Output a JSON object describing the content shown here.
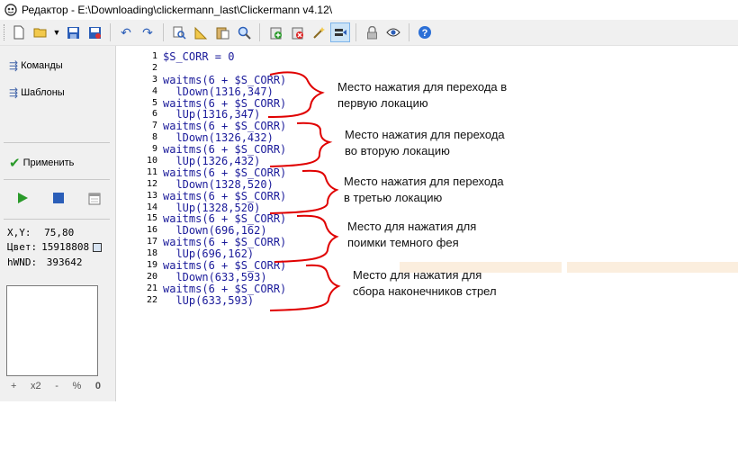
{
  "title": "Редактор - E:\\Downloading\\clickermann_last\\Clickermann v4.12\\",
  "toolbar": {
    "icons": [
      "new-file",
      "open-folder",
      "dropdown",
      "save",
      "save-as",
      "undo",
      "redo",
      "find",
      "measure",
      "paste",
      "search",
      "add",
      "delete",
      "magic-wand",
      "send",
      "lock",
      "eye",
      "help"
    ],
    "active": "send"
  },
  "sidebar": {
    "commands_label": "Команды",
    "templates_label": "Шаблоны",
    "apply_label": "Применить",
    "xy_label": "X,Y:",
    "xy_value": "75,80",
    "color_label": "Цвет:",
    "color_value": "15918808",
    "hwnd_label": "hWND:",
    "hwnd_value": "393642",
    "zoom": [
      "+",
      "x2",
      "-",
      "%",
      "0"
    ]
  },
  "editor": {
    "line_numbers": [
      "1",
      "2",
      "3",
      "4",
      "5",
      "6",
      "7",
      "8",
      "9",
      "10",
      "11",
      "12",
      "13",
      "14",
      "15",
      "16",
      "17",
      "18",
      "19",
      "20",
      "21",
      "22"
    ],
    "lines": [
      "$S_CORR = 0",
      "",
      "waitms(6 + $S_CORR)",
      "  lDown(1316,347)",
      "waitms(6 + $S_CORR)",
      "  lUp(1316,347)",
      "waitms(6 + $S_CORR)",
      "  lDown(1326,432)",
      "waitms(6 + $S_CORR)",
      "  lUp(1326,432)",
      "waitms(6 + $S_CORR)",
      "  lDown(1328,520)",
      "waitms(6 + $S_CORR)",
      "  lUp(1328,520)",
      "waitms(6 + $S_CORR)",
      "  lDown(696,162)",
      "waitms(6 + $S_CORR)",
      "  lUp(696,162)",
      "waitms(6 + $S_CORR)",
      "  lDown(633,593)",
      "waitms(6 + $S_CORR)",
      "  lUp(633,593)"
    ]
  },
  "annotations": [
    {
      "line1": "Место нажатия для перехода в",
      "line2": "первую локацию"
    },
    {
      "line1": "Место нажатия для перехода",
      "line2": "во вторую локацию"
    },
    {
      "line1": "Место нажатия для перехода",
      "line2": "в третью локацию"
    },
    {
      "line1": "Место для нажатия для",
      "line2": "поимки темного фея"
    },
    {
      "line1": "Место для нажатия для",
      "line2": "сбора наконечников стрел"
    }
  ],
  "colors": {
    "code": "#1a1a9a",
    "brace": "#e00000",
    "panel": "#f0f0f0",
    "color_swatch": "#d8e4f2"
  }
}
